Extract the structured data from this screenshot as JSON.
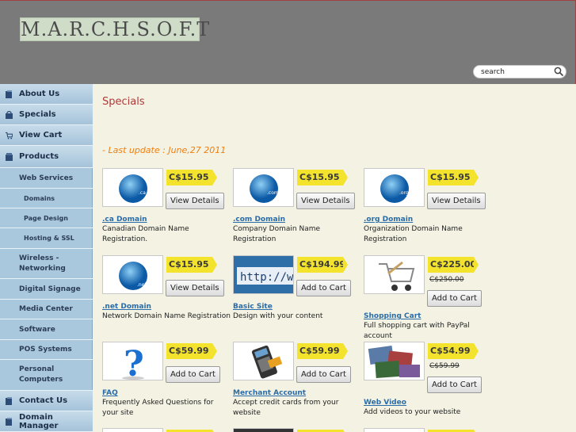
{
  "header": {
    "logo_text": "M.A.R.C.H.S.O.F.T",
    "search_placeholder": "search"
  },
  "sidebar": {
    "items": [
      {
        "label": "About Us",
        "type": "main",
        "icon": "book-icon"
      },
      {
        "label": "Specials",
        "type": "main",
        "icon": "bag-icon"
      },
      {
        "label": "View Cart",
        "type": "main",
        "icon": "cart-icon"
      },
      {
        "label": "Products",
        "type": "main",
        "icon": "box-icon"
      },
      {
        "label": "Web Services",
        "type": "sub"
      },
      {
        "label": "Domains",
        "type": "sub2"
      },
      {
        "label": "Page Design",
        "type": "sub2"
      },
      {
        "label": "Hosting & SSL",
        "type": "sub2"
      },
      {
        "label": "Wireless - Networking",
        "type": "sub"
      },
      {
        "label": "Digital Signage",
        "type": "sub"
      },
      {
        "label": "Media Center",
        "type": "sub"
      },
      {
        "label": "Software",
        "type": "sub"
      },
      {
        "label": "POS Systems",
        "type": "sub"
      },
      {
        "label": "Personal Computers",
        "type": "sub"
      },
      {
        "label": "Contact Us",
        "type": "main",
        "icon": "book-icon"
      },
      {
        "label": "Domain Manager",
        "type": "main",
        "icon": "book-icon"
      }
    ]
  },
  "main": {
    "title": "Specials",
    "update": "- Last update : June,27 2011",
    "products": [
      {
        "name": ".ca Domain",
        "desc": "Canadian Domain Name Registration.",
        "price": "C$15.95",
        "old": "",
        "button": "View Details",
        "image": "globe-ca"
      },
      {
        "name": ".com Domain",
        "desc": "Company Domain Name Registration",
        "price": "C$15.95",
        "old": "",
        "button": "View Details",
        "image": "globe-com"
      },
      {
        "name": ".org Domain",
        "desc": "Organization Domain Name Registration",
        "price": "C$15.95",
        "old": "",
        "button": "View Details",
        "image": "globe-org"
      },
      {
        "name": ".net Domain",
        "desc": "Network Domain Name Registration",
        "price": "C$15.95",
        "old": "",
        "button": "View Details",
        "image": "globe-net"
      },
      {
        "name": "Basic Site",
        "desc": "Design with your content",
        "price": "C$194.99",
        "old": "",
        "button": "Add to Cart",
        "image": "http-address"
      },
      {
        "name": "Shopping Cart",
        "desc": "Full shopping cart with PayPal account",
        "price": "C$225.00",
        "old": "C$250.00",
        "button": "Add to Cart",
        "image": "cart-image"
      },
      {
        "name": "FAQ",
        "desc": "Frequently Asked Questions for your site",
        "price": "C$59.99",
        "old": "",
        "button": "Add to Cart",
        "image": "question-mark"
      },
      {
        "name": "Merchant Account",
        "desc": "Accept credit cards from your website",
        "price": "C$59.99",
        "old": "",
        "button": "Add to Cart",
        "image": "card-terminal"
      },
      {
        "name": "Web Video",
        "desc": "Add videos to your website",
        "price": "C$54.99",
        "old": "C$59.99",
        "button": "Add to Cart",
        "image": "video-collage"
      }
    ]
  }
}
